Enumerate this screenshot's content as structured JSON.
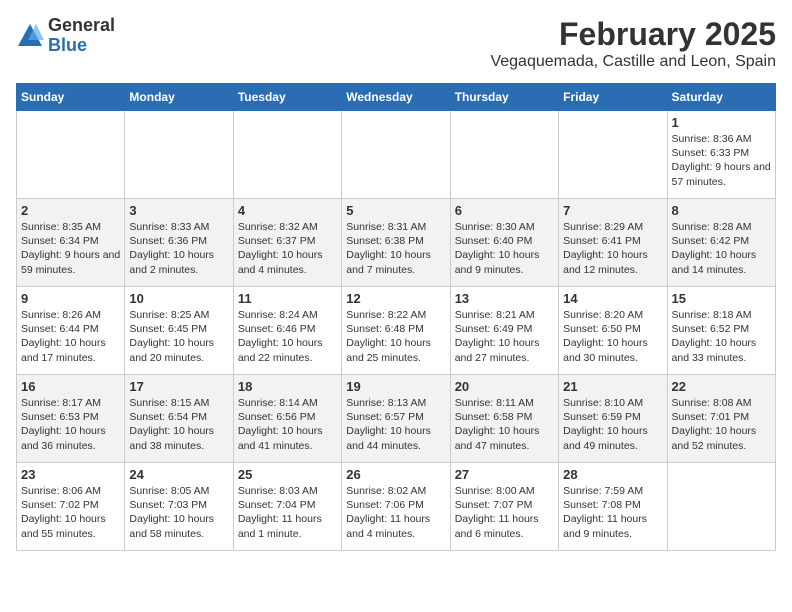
{
  "header": {
    "logo": {
      "general": "General",
      "blue": "Blue"
    },
    "month": "February 2025",
    "location": "Vegaquemada, Castille and Leon, Spain"
  },
  "weekdays": [
    "Sunday",
    "Monday",
    "Tuesday",
    "Wednesday",
    "Thursday",
    "Friday",
    "Saturday"
  ],
  "weeks": [
    [
      {
        "day": "",
        "info": ""
      },
      {
        "day": "",
        "info": ""
      },
      {
        "day": "",
        "info": ""
      },
      {
        "day": "",
        "info": ""
      },
      {
        "day": "",
        "info": ""
      },
      {
        "day": "",
        "info": ""
      },
      {
        "day": "1",
        "info": "Sunrise: 8:36 AM\nSunset: 6:33 PM\nDaylight: 9 hours and 57 minutes."
      }
    ],
    [
      {
        "day": "2",
        "info": "Sunrise: 8:35 AM\nSunset: 6:34 PM\nDaylight: 9 hours and 59 minutes."
      },
      {
        "day": "3",
        "info": "Sunrise: 8:33 AM\nSunset: 6:36 PM\nDaylight: 10 hours and 2 minutes."
      },
      {
        "day": "4",
        "info": "Sunrise: 8:32 AM\nSunset: 6:37 PM\nDaylight: 10 hours and 4 minutes."
      },
      {
        "day": "5",
        "info": "Sunrise: 8:31 AM\nSunset: 6:38 PM\nDaylight: 10 hours and 7 minutes."
      },
      {
        "day": "6",
        "info": "Sunrise: 8:30 AM\nSunset: 6:40 PM\nDaylight: 10 hours and 9 minutes."
      },
      {
        "day": "7",
        "info": "Sunrise: 8:29 AM\nSunset: 6:41 PM\nDaylight: 10 hours and 12 minutes."
      },
      {
        "day": "8",
        "info": "Sunrise: 8:28 AM\nSunset: 6:42 PM\nDaylight: 10 hours and 14 minutes."
      }
    ],
    [
      {
        "day": "9",
        "info": "Sunrise: 8:26 AM\nSunset: 6:44 PM\nDaylight: 10 hours and 17 minutes."
      },
      {
        "day": "10",
        "info": "Sunrise: 8:25 AM\nSunset: 6:45 PM\nDaylight: 10 hours and 20 minutes."
      },
      {
        "day": "11",
        "info": "Sunrise: 8:24 AM\nSunset: 6:46 PM\nDaylight: 10 hours and 22 minutes."
      },
      {
        "day": "12",
        "info": "Sunrise: 8:22 AM\nSunset: 6:48 PM\nDaylight: 10 hours and 25 minutes."
      },
      {
        "day": "13",
        "info": "Sunrise: 8:21 AM\nSunset: 6:49 PM\nDaylight: 10 hours and 27 minutes."
      },
      {
        "day": "14",
        "info": "Sunrise: 8:20 AM\nSunset: 6:50 PM\nDaylight: 10 hours and 30 minutes."
      },
      {
        "day": "15",
        "info": "Sunrise: 8:18 AM\nSunset: 6:52 PM\nDaylight: 10 hours and 33 minutes."
      }
    ],
    [
      {
        "day": "16",
        "info": "Sunrise: 8:17 AM\nSunset: 6:53 PM\nDaylight: 10 hours and 36 minutes."
      },
      {
        "day": "17",
        "info": "Sunrise: 8:15 AM\nSunset: 6:54 PM\nDaylight: 10 hours and 38 minutes."
      },
      {
        "day": "18",
        "info": "Sunrise: 8:14 AM\nSunset: 6:56 PM\nDaylight: 10 hours and 41 minutes."
      },
      {
        "day": "19",
        "info": "Sunrise: 8:13 AM\nSunset: 6:57 PM\nDaylight: 10 hours and 44 minutes."
      },
      {
        "day": "20",
        "info": "Sunrise: 8:11 AM\nSunset: 6:58 PM\nDaylight: 10 hours and 47 minutes."
      },
      {
        "day": "21",
        "info": "Sunrise: 8:10 AM\nSunset: 6:59 PM\nDaylight: 10 hours and 49 minutes."
      },
      {
        "day": "22",
        "info": "Sunrise: 8:08 AM\nSunset: 7:01 PM\nDaylight: 10 hours and 52 minutes."
      }
    ],
    [
      {
        "day": "23",
        "info": "Sunrise: 8:06 AM\nSunset: 7:02 PM\nDaylight: 10 hours and 55 minutes."
      },
      {
        "day": "24",
        "info": "Sunrise: 8:05 AM\nSunset: 7:03 PM\nDaylight: 10 hours and 58 minutes."
      },
      {
        "day": "25",
        "info": "Sunrise: 8:03 AM\nSunset: 7:04 PM\nDaylight: 11 hours and 1 minute."
      },
      {
        "day": "26",
        "info": "Sunrise: 8:02 AM\nSunset: 7:06 PM\nDaylight: 11 hours and 4 minutes."
      },
      {
        "day": "27",
        "info": "Sunrise: 8:00 AM\nSunset: 7:07 PM\nDaylight: 11 hours and 6 minutes."
      },
      {
        "day": "28",
        "info": "Sunrise: 7:59 AM\nSunset: 7:08 PM\nDaylight: 11 hours and 9 minutes."
      },
      {
        "day": "",
        "info": ""
      }
    ]
  ]
}
